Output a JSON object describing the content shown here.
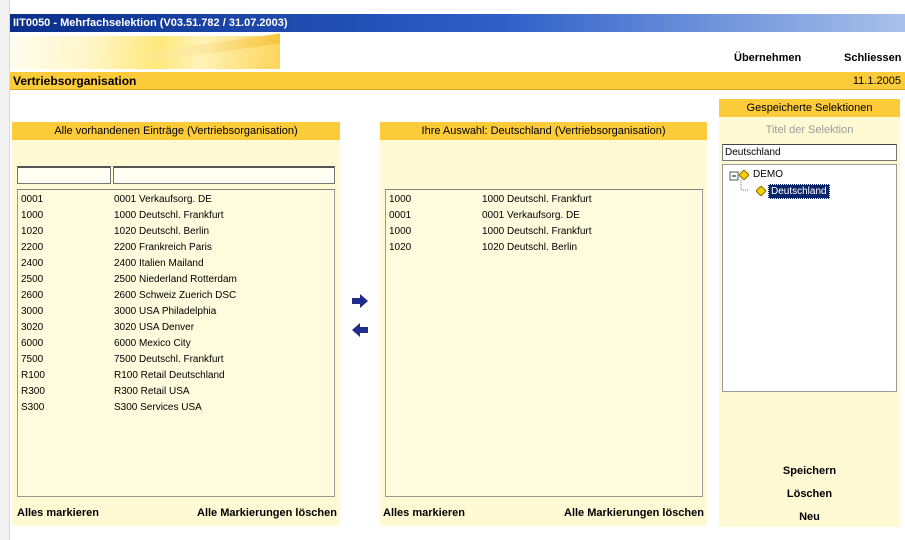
{
  "window": {
    "title": "IIT0050 - Mehrfachselektion (V03.51.782 / 31.07.2003)"
  },
  "toolbar": {
    "accept_label": "Übernehmen",
    "close_label": "Schliessen"
  },
  "header": {
    "title": "Vertriebsorganisation",
    "date": "11.1.2005"
  },
  "left_panel": {
    "heading": "Alle vorhandenen Einträge (Vertriebsorganisation)",
    "filter_code": "",
    "filter_name": "",
    "items": [
      {
        "code": "0001",
        "name": "0001 Verkaufsorg. DE"
      },
      {
        "code": "1000",
        "name": "1000 Deutschl. Frankfurt"
      },
      {
        "code": "1020",
        "name": "1020 Deutschl. Berlin"
      },
      {
        "code": "2200",
        "name": "2200 Frankreich Paris"
      },
      {
        "code": "2400",
        "name": "2400 Italien Mailand"
      },
      {
        "code": "2500",
        "name": "2500 Niederland Rotterdam"
      },
      {
        "code": "2600",
        "name": "2600 Schweiz Zuerich DSC"
      },
      {
        "code": "3000",
        "name": "3000 USA Philadelphia"
      },
      {
        "code": "3020",
        "name": "3020 USA Denver"
      },
      {
        "code": "6000",
        "name": "6000 Mexico City"
      },
      {
        "code": "7500",
        "name": "7500 Deutschl. Frankfurt"
      },
      {
        "code": "R100",
        "name": "R100 Retail Deutschland"
      },
      {
        "code": "R300",
        "name": "R300 Retail USA"
      },
      {
        "code": "S300",
        "name": "S300 Services USA"
      }
    ],
    "select_all_label": "Alles markieren",
    "clear_all_label": "Alle Markierungen löschen"
  },
  "right_panel": {
    "heading": "Ihre Auswahl: Deutschland (Vertriebsorganisation)",
    "items": [
      {
        "code": "1000",
        "name": "1000 Deutschl. Frankfurt"
      },
      {
        "code": "0001",
        "name": "0001 Verkaufsorg. DE"
      },
      {
        "code": "1000",
        "name": "1000 Deutschl. Frankfurt"
      },
      {
        "code": "1020",
        "name": "1020 Deutschl. Berlin"
      }
    ],
    "select_all_label": "Alles markieren",
    "clear_all_label": "Alle Markierungen löschen"
  },
  "arrows": {
    "add_icon": "arrow-right-icon",
    "remove_icon": "arrow-left-icon"
  },
  "saved_selections": {
    "heading": "Gespeicherte Selektionen",
    "title_label": "Titel der Selektion",
    "title_value": "Deutschland",
    "tree": {
      "root_label": "DEMO",
      "child_label": "Deutschland"
    },
    "save_label": "Speichern",
    "delete_label": "Löschen",
    "new_label": "Neu"
  },
  "colors": {
    "accent": "#fccb3a",
    "panel": "#fffad3",
    "titlebar": "#0a2e8a",
    "arrow": "#1f2d8f",
    "tree_selected": "#0a246a"
  }
}
